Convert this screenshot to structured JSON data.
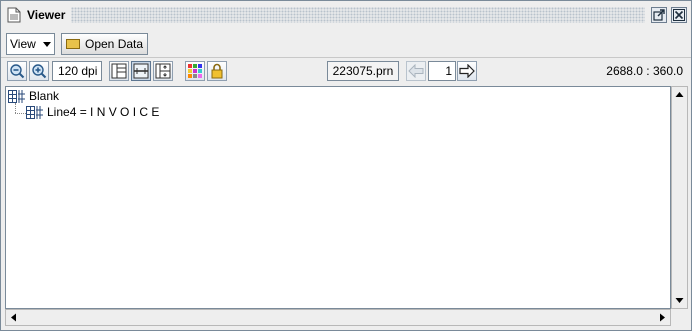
{
  "window": {
    "title": "Viewer",
    "maximize_glyph": "↗",
    "close_glyph": "✕"
  },
  "toolbar1": {
    "view_combo_value": "View",
    "open_data_label": "Open Data"
  },
  "toolbar2": {
    "zoom_out_icon": "zoom-out-icon",
    "zoom_in_icon": "zoom-in-icon",
    "dpi_value": "120 dpi",
    "file_name": "223075.prn",
    "page_number": "1",
    "position_readout": "2688.0 : 360.0"
  },
  "tree": {
    "root_label": "Blank",
    "child_label": "Line4 = I N V O I C E"
  },
  "colors": {
    "accent": "#3a6ea5",
    "border": "#7a8a99"
  }
}
